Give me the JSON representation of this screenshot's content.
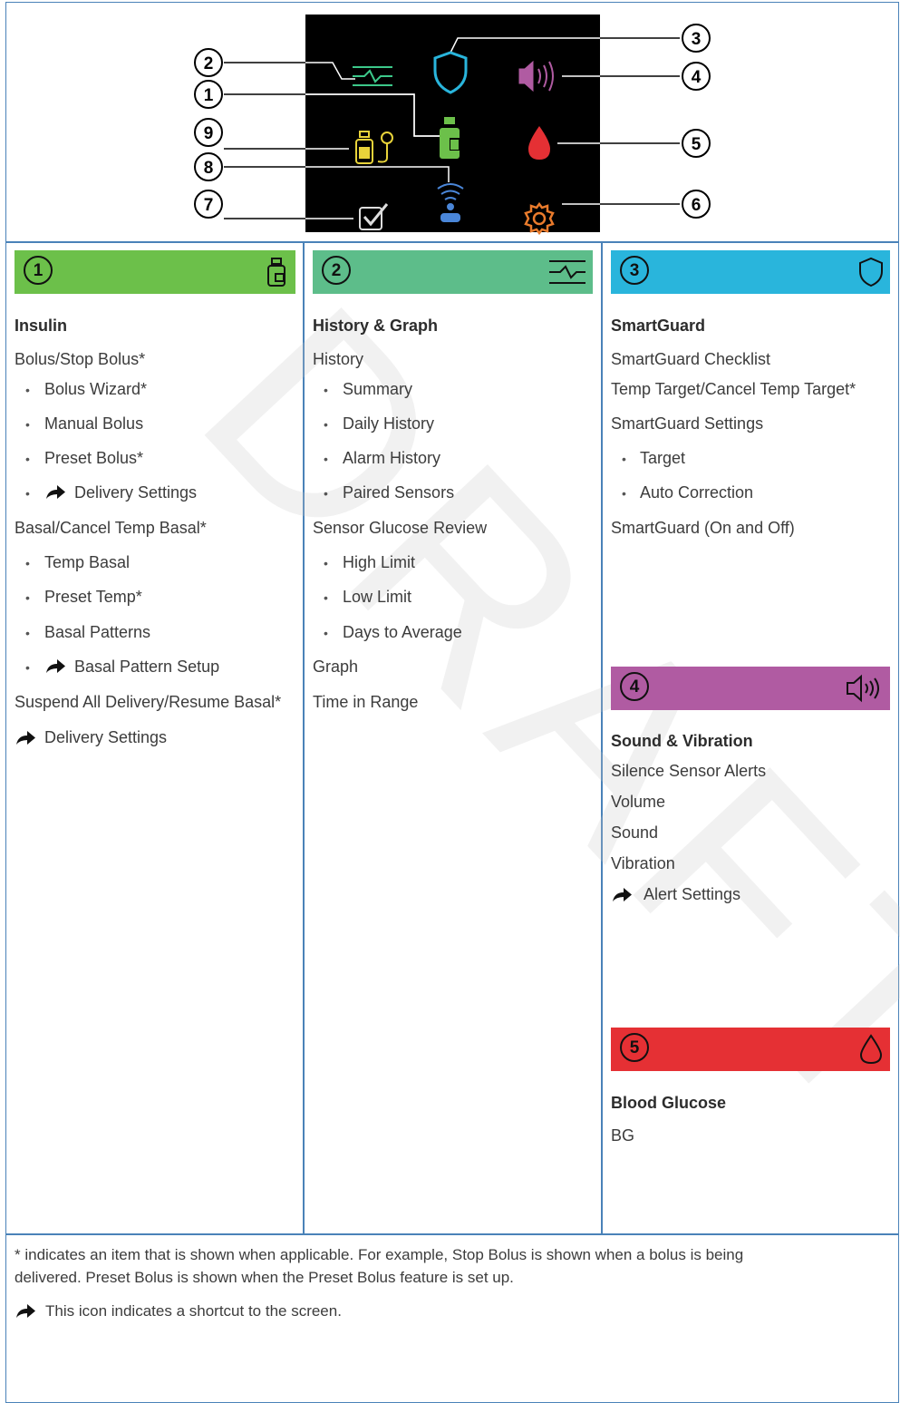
{
  "watermark": "DRAFT",
  "callouts": [
    "1",
    "2",
    "3",
    "4",
    "5",
    "6",
    "7",
    "8",
    "9"
  ],
  "sections": {
    "insulin": {
      "number": "1",
      "color": "#6cc04a",
      "icon": "insulin-vial-icon",
      "title": "Insulin",
      "items": [
        "Bolus/Stop Bolus*",
        "Bolus Wizard*",
        "Manual Bolus",
        "Preset Bolus*",
        "Delivery Settings",
        "Basal/Cancel Temp Basal*",
        "Temp Basal",
        "Preset Temp*",
        "Basal Patterns",
        "Basal Pattern Setup",
        "Suspend All Delivery/Resume Basal*",
        "Delivery Settings"
      ]
    },
    "history": {
      "number": "2",
      "color": "#5dbd8a",
      "icon": "history-graph-icon",
      "title": "History & Graph",
      "items": [
        "History",
        "Summary",
        "Daily History",
        "Alarm History",
        "Paired Sensors",
        "Sensor Glucose Review",
        "High Limit",
        "Low Limit",
        "Days to Average",
        "Graph",
        "Time in Range"
      ]
    },
    "smartguard": {
      "number": "3",
      "color": "#29b5dc",
      "icon": "shield-icon",
      "title": "SmartGuard",
      "items": [
        "SmartGuard Checklist",
        "Temp Target/Cancel Temp Target*",
        "SmartGuard Settings",
        "Target",
        "Auto Correction",
        "SmartGuard (On and Off)"
      ]
    },
    "sound": {
      "number": "4",
      "color": "#b05ba2",
      "icon": "speaker-icon",
      "title": "Sound & Vibration",
      "items": [
        "Silence Sensor Alerts",
        "Volume",
        "Sound",
        "Vibration",
        "Alert Settings"
      ]
    },
    "bg": {
      "number": "5",
      "color": "#e53034",
      "icon": "drop-icon",
      "title": "Blood Glucose",
      "items": [
        "BG"
      ]
    }
  },
  "footer": {
    "note_line1": "* indicates an item that is shown when applicable. For example, Stop Bolus is shown when a bolus is being",
    "note_line2": "delivered. Preset Bolus is shown when the Preset Bolus feature is set up.",
    "shortcut_note": "This icon indicates a shortcut to the screen."
  }
}
